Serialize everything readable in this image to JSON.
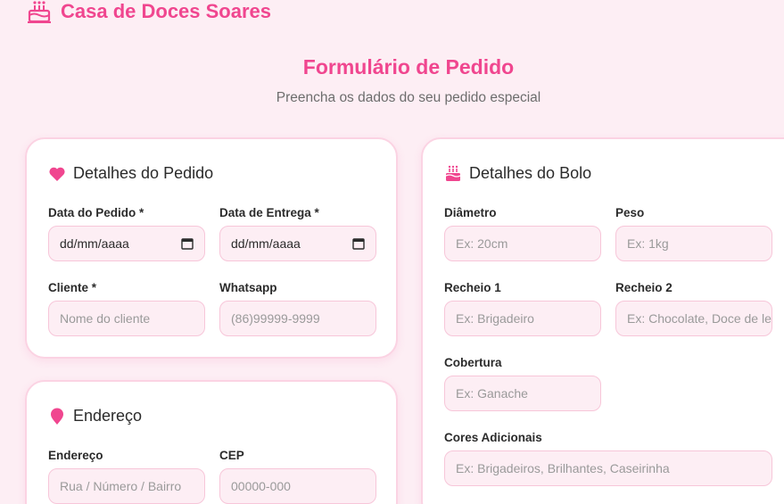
{
  "brand": {
    "name": "Casa de Doces Soares",
    "icon": "cake-icon"
  },
  "header": {
    "title": "Formulário de Pedido",
    "subtitle": "Preencha os dados do seu pedido especial"
  },
  "pedido": {
    "title": "Detalhes do Pedido",
    "icon": "heart-icon",
    "data_pedido_label": "Data do Pedido *",
    "data_pedido_value": "dd/mm/aaaa",
    "data_entrega_label": "Data de Entrega *",
    "data_entrega_value": "dd/mm/aaaa",
    "cliente_label": "Cliente *",
    "cliente_placeholder": "Nome do cliente",
    "whatsapp_label": "Whatsapp",
    "whatsapp_placeholder": "(86)99999-9999"
  },
  "bolo": {
    "title": "Detalhes do Bolo",
    "icon": "cake-icon",
    "diametro_label": "Diâmetro",
    "diametro_placeholder": "Ex: 20cm",
    "peso_label": "Peso",
    "peso_placeholder": "Ex: 1kg",
    "recheio1_label": "Recheio 1",
    "recheio1_placeholder": "Ex: Brigadeiro",
    "recheio2_label": "Recheio 2",
    "recheio2_placeholder": "Ex: Chocolate, Doce de leite",
    "cobertura_label": "Cobertura",
    "cobertura_placeholder": "Ex: Ganache",
    "cores_label": "Cores Adicionais",
    "cores_placeholder": "Ex: Brigadeiros, Brilhantes, Caseirinha"
  },
  "endereco": {
    "title": "Endereço",
    "icon": "map-pin-icon",
    "endereco_label": "Endereço",
    "endereco_placeholder": "Rua / Número / Bairro",
    "cep_label": "CEP",
    "cep_placeholder": "00000-000"
  },
  "colors": {
    "accent": "#f0468f",
    "background": "#fdeef4",
    "field": "#fdeef4"
  }
}
